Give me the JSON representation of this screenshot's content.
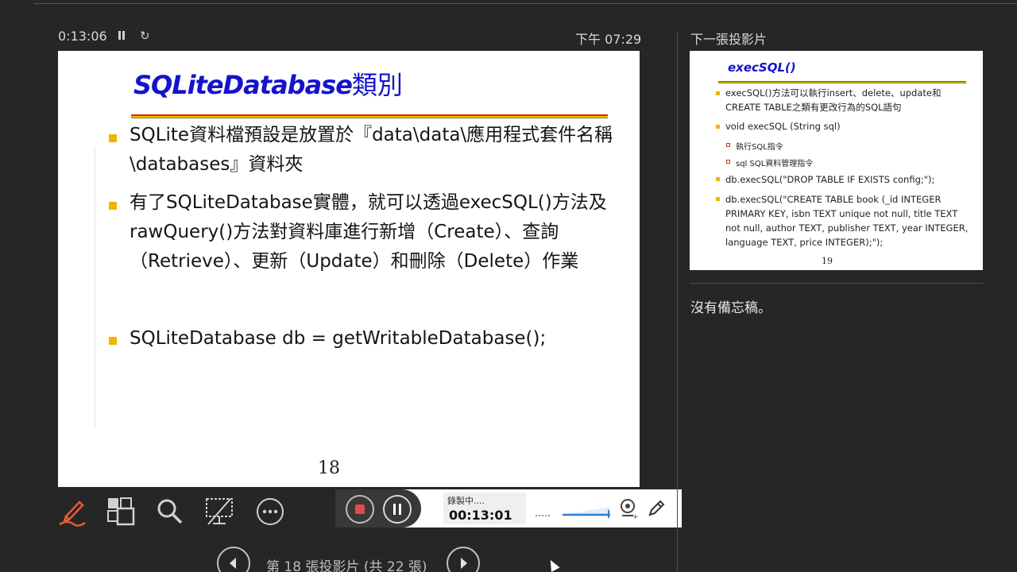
{
  "header": {
    "elapsed_time": "0:13:06",
    "clock": "下午 07:29"
  },
  "current_slide": {
    "title_latin": "SQLiteDatabase",
    "title_cjk": "類別",
    "bullets": [
      "SQLite資料檔預設是放置於『data\\data\\應用程式套件名稱\\databases』資料夾",
      "有了SQLiteDatabase實體，就可以透過execSQL()方法及rawQuery()方法對資料庫進行新增（Create）、查詢（Retrieve）、更新（Update）和刪除（Delete）作業",
      "SQLiteDatabase db = getWritableDatabase();"
    ],
    "number": "18"
  },
  "toolbar": {
    "icons": [
      "pen-icon",
      "slides-grid-icon",
      "zoom-icon",
      "black-screen-icon",
      "more-options-icon"
    ]
  },
  "recording": {
    "status_label": "錄製中....",
    "time": "00:13:01"
  },
  "navigation": {
    "slide_count": "第 18 張投影片 (共 22 張)"
  },
  "next_slide": {
    "label": "下一張投影片",
    "title": "execSQL()",
    "bullets": [
      "execSQL()方法可以執行insert、delete、update和CREATE TABLE之類有更改行為的SQL語句",
      "void execSQL (String sql)",
      "db.execSQL(\"DROP TABLE IF EXISTS config;\");",
      "db.execSQL(\"CREATE TABLE book (_id INTEGER PRIMARY KEY, isbn TEXT unique not null, title TEXT not null, author TEXT, publisher TEXT, year INTEGER, language TEXT, price INTEGER);\");"
    ],
    "sub_bullets": [
      "執行SQL指令",
      "sql  SQL資料管理指令"
    ],
    "number": "19"
  },
  "notes": {
    "text": "沒有備忘稿。"
  },
  "colors": {
    "background": "#262626",
    "title_blue": "#1414cc",
    "bullet_yellow": "#f3b400",
    "record_red": "#e04b4b",
    "accent_blue": "#2a7fd4"
  }
}
